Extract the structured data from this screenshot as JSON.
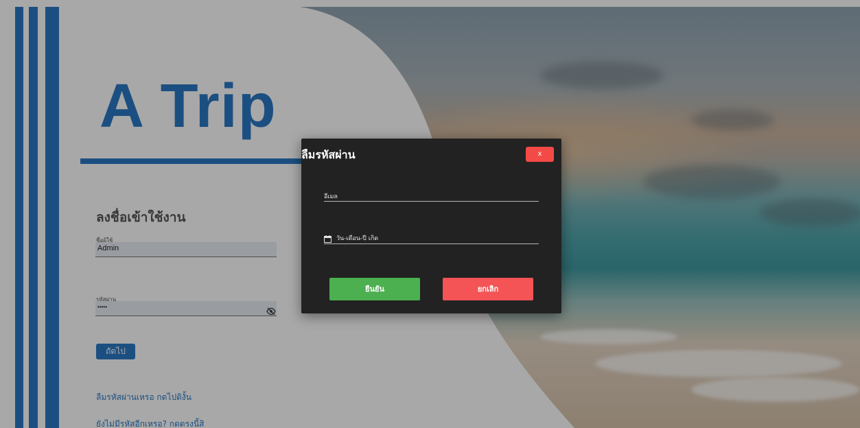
{
  "app": {
    "logo_text": "A Trip"
  },
  "login": {
    "title": "ลงชื่อเข้าใช้งาน",
    "username_label": "ชื่อผู้ใช้",
    "username_value": "Admin",
    "password_label": "รหัสผ่าน",
    "password_value": "•••••",
    "next_button": "ถัดไป",
    "forgot_link": "ลืมรหัสผ่านเหรอ กดไปดิงั้น",
    "register_link": "ยังไม่มีรหัสอีกเหรอ? กดตรงนี้สิ"
  },
  "dialog": {
    "title": "ลืมรหัสผ่าน",
    "close_label": "x",
    "email_label": "อีเมล",
    "birthdate_label": "วัน-เดือน-ปี เกิด",
    "confirm_button": "ยืนยัน",
    "cancel_button": "ยกเลิก"
  },
  "colors": {
    "brand_blue": "#2b79c4",
    "dialog_bg": "#222222",
    "confirm_green": "#4caf50",
    "cancel_red": "#f45455",
    "close_red": "#f44a47"
  },
  "icons": {
    "password_toggle": "eye-off-icon",
    "birthdate": "calendar-icon"
  }
}
